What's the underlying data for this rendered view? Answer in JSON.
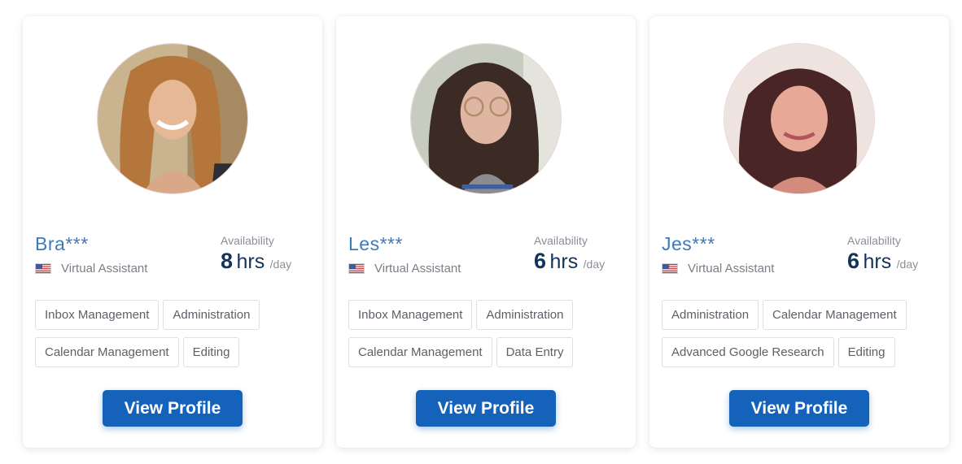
{
  "colors": {
    "name": "#3d79bd",
    "button": "#1462b9",
    "hours": "#12335a",
    "muted": "#8a8f96"
  },
  "profiles": [
    {
      "name": "Bra***",
      "flag_icon": "us-flag-icon",
      "role": "Virtual Assistant",
      "availability_label": "Availability",
      "hours": "8",
      "hours_unit": "hrs",
      "per": "/day",
      "tags": [
        "Inbox Management",
        "Administration",
        "Calendar Management",
        "Editing"
      ],
      "button": "View Profile"
    },
    {
      "name": "Les***",
      "flag_icon": "us-flag-icon",
      "role": "Virtual Assistant",
      "availability_label": "Availability",
      "hours": "6",
      "hours_unit": "hrs",
      "per": "/day",
      "tags": [
        "Inbox Management",
        "Administration",
        "Calendar Management",
        "Data Entry"
      ],
      "button": "View Profile"
    },
    {
      "name": "Jes***",
      "flag_icon": "us-flag-icon",
      "role": "Virtual Assistant",
      "availability_label": "Availability",
      "hours": "6",
      "hours_unit": "hrs",
      "per": "/day",
      "tags": [
        "Administration",
        "Calendar Management",
        "Advanced Google Research",
        "Editing"
      ],
      "button": "View Profile"
    }
  ]
}
